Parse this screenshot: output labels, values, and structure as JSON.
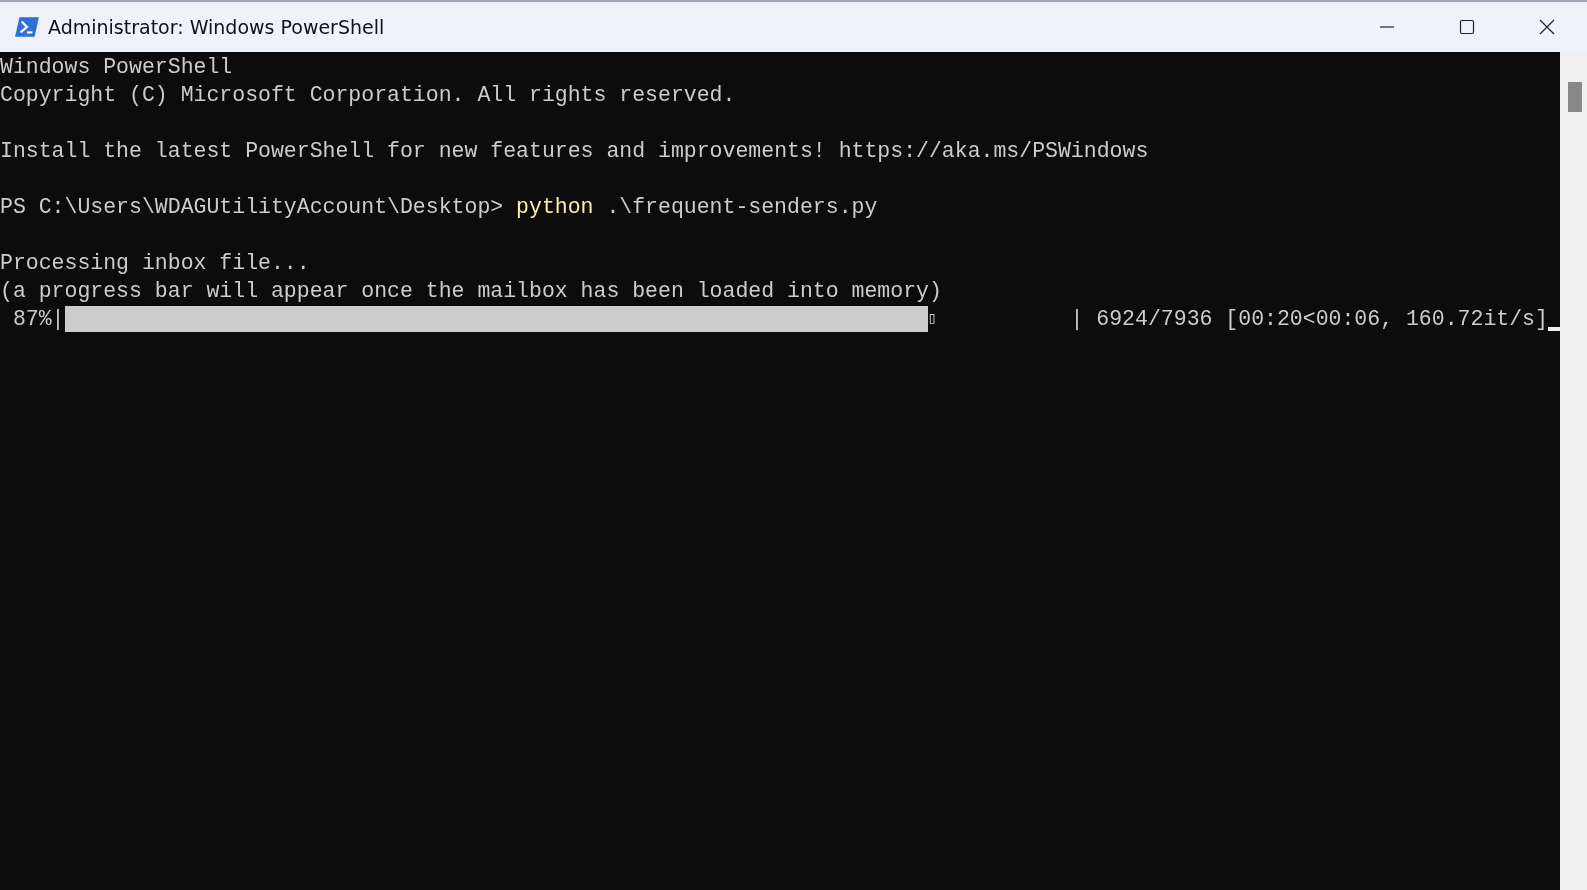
{
  "window": {
    "title": "Administrator: Windows PowerShell"
  },
  "lines": [
    {
      "kind": "text",
      "text": "Windows PowerShell"
    },
    {
      "kind": "text",
      "text": "Copyright (C) Microsoft Corporation. All rights reserved."
    },
    {
      "kind": "blank"
    },
    {
      "kind": "text",
      "text": "Install the latest PowerShell for new features and improvements! https://aka.ms/PSWindows"
    },
    {
      "kind": "blank"
    },
    {
      "kind": "command",
      "prompt": "PS C:\\Users\\WDAGUtilityAccount\\Desktop>",
      "command": "python",
      "args": ".\\frequent-senders.py"
    },
    {
      "kind": "blank"
    },
    {
      "kind": "text",
      "text": "Processing inbox file..."
    },
    {
      "kind": "text",
      "text": "(a progress bar will appear once the mailbox has been loaded into memory)"
    },
    {
      "kind": "progress",
      "percent": " 87%|",
      "level": 0.87,
      "glyph": "▯",
      "stats": "| 6924/7936 [00:20<00:06, 160.72it/s]"
    }
  ]
}
